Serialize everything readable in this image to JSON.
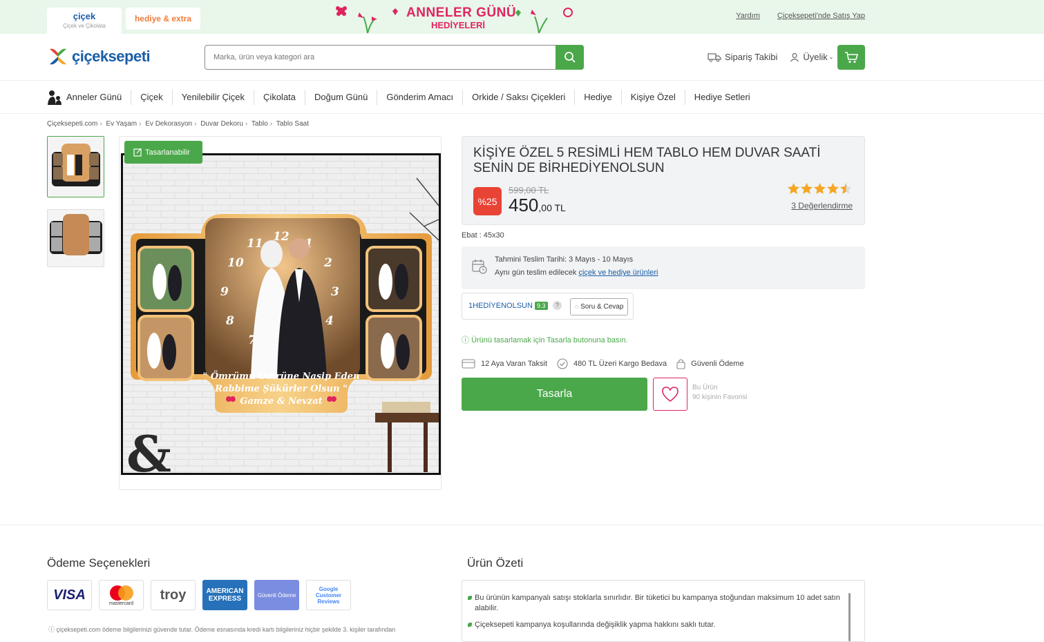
{
  "topbar": {
    "tab_cicek_title": "çiçek",
    "tab_cicek_sub": "Çiçek ve Çikolata",
    "tab_hediye": "hediye & extra",
    "promo_line1": "ANNELER GÜNÜ",
    "promo_line2": "HEDİYELERİ",
    "links": [
      "Yardım",
      "Çiçeksepeti'nde Satış Yap"
    ]
  },
  "header": {
    "logo_text": "çiçeksepeti",
    "search_placeholder": "Marka, ürün veya kategori ara",
    "order_tracking": "Sipariş Takibi",
    "membership": "Üyelik"
  },
  "nav": {
    "items": [
      "Anneler Günü",
      "Çiçek",
      "Yenilebilir Çiçek",
      "Çikolata",
      "Doğum Günü",
      "Gönderim Amacı",
      "Orkide / Saksı Çiçekleri",
      "Hediye",
      "Kişiye Özel",
      "Hediye Setleri"
    ]
  },
  "breadcrumb": [
    "Çiçeksepeti.com",
    "Ev Yaşam",
    "Ev Dekorasyon",
    "Duvar Dekoru",
    "Tablo",
    "Tablo Saat"
  ],
  "product": {
    "custom_badge": "Tasarlanabilir",
    "title": "KİŞİYE ÖZEL 5 RESİMLİ HEM TABLO HEM DUVAR SAATİ SENİN DE BİRHEDİYENOLSUN",
    "discount": "%25",
    "old_price": "599,00 TL",
    "price_main": "450",
    "price_cents": ",00 TL",
    "rating": 4.5,
    "reviews": "3 Değerlendirme",
    "size": "Ebat : 45x30",
    "image_text_line1": "\" Ömrümü Ömrüne Nasip Eden",
    "image_text_line2": "Rabbime Şükürler Olsun \"",
    "image_text_line3": "\" Gamze & Nevzat \""
  },
  "delivery": {
    "estimate": "Tahmini Teslim Tarihi: 3 Mayıs - 10 Mayıs",
    "same_day_prefix": "Aynı gün teslim edilecek ",
    "same_day_link": "çiçek ve hediye ürünleri"
  },
  "seller": {
    "name": "1HEDİYENOLSUN",
    "score": "9.3",
    "help": "?",
    "qa_button": "Soru & Cevap"
  },
  "hint": "Ürünü tasarlamak için Tasarla butonuna basın.",
  "features": [
    "12 Aya Varan Taksit",
    "480 TL Üzeri Kargo Bedava",
    "Güvenli Ödeme"
  ],
  "actions": {
    "design_button": "Tasarla",
    "fav_line1": "Bu Ürün",
    "fav_line2": "90 kişinin Favorisi"
  },
  "payment": {
    "title": "Ödeme Seçenekleri",
    "cards": [
      "VISA",
      "mastercard",
      "troy",
      "AMERICAN EXPRESS",
      "Güvenli Ödeme",
      "Google Customer Reviews"
    ],
    "note": "çiçeksepeti.com ödeme bilgilerinizi güvende tutar. Ödeme esnasında kredi kartı bilgileriniz hiçbir şekilde 3. kişiler tarafından"
  },
  "summary": {
    "title": "Ürün Özeti",
    "bullets": [
      "Bu ürünün kampanyalı satışı stoklarla sınırlıdır. Bir tüketici bu kampanya stoğundan maksimum 10 adet satın alabilir.",
      "Çiçeksepeti kampanya koşullarında değişiklik yapma hakkını saklı tutar."
    ]
  },
  "colors": {
    "brand_blue": "#1a5ea8",
    "green": "#4aa84a",
    "red": "#e94335",
    "pink": "#e0245e",
    "star": "#f5a623"
  }
}
